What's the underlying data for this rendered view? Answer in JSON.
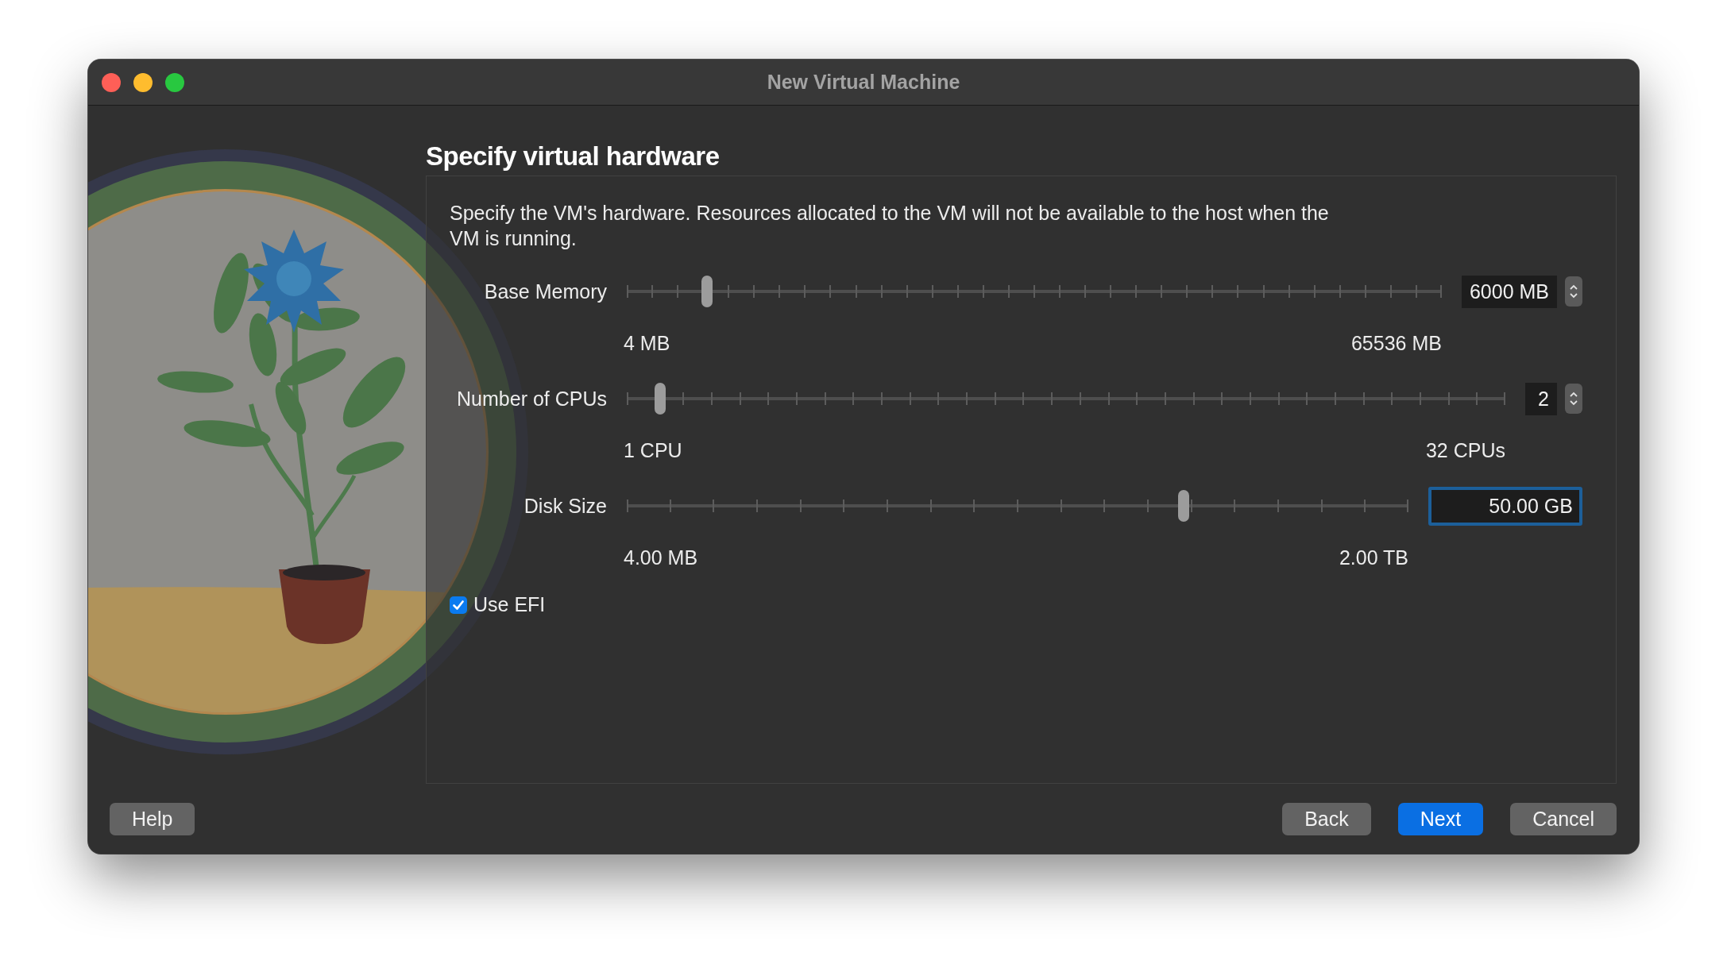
{
  "window": {
    "title": "New Virtual Machine"
  },
  "page": {
    "heading": "Specify virtual hardware",
    "description": "Specify the VM's hardware. Resources allocated to the VM will not be available to the host when the VM is running."
  },
  "settings": [
    {
      "kind": "spin",
      "label": "Base Memory",
      "level": 0.098,
      "value": "6000 MB",
      "min_label": "4 MB",
      "max_label": "65536 MB",
      "focused": false
    },
    {
      "kind": "spin",
      "label": "Number of CPUs",
      "level": 0.038,
      "value": "2",
      "min_label": "1 CPU",
      "max_label": "32 CPUs",
      "focused": false
    },
    {
      "kind": "field",
      "label": "Disk Size",
      "level": 0.712,
      "value": "50.00 GB",
      "min_label": "4.00 MB",
      "max_label": "2.00 TB",
      "focused": true
    }
  ],
  "use_efi": {
    "label": "Use EFI",
    "checked": true
  },
  "help_button": "Help",
  "buttons": [
    {
      "label": "Back",
      "default": false
    },
    {
      "label": "Next",
      "default": true
    },
    {
      "label": "Cancel",
      "default": false
    }
  ]
}
